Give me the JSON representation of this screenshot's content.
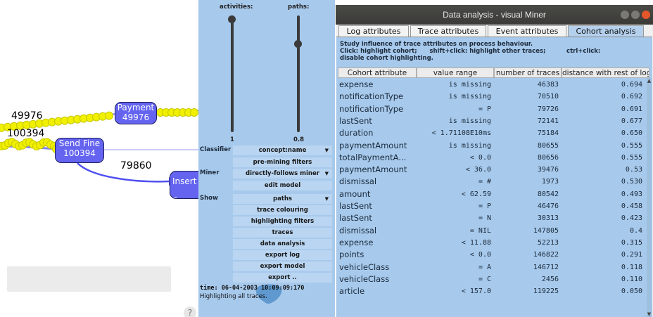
{
  "graph": {
    "nodes": [
      {
        "id": "payment",
        "label": "Payment",
        "count": "49976"
      },
      {
        "id": "send-fine",
        "label": "Send Fine",
        "count": "100394"
      },
      {
        "id": "insert-fine",
        "label": "Insert F"
      }
    ],
    "edge_labels": [
      "49976",
      "100394",
      "79860"
    ],
    "help_label": "?"
  },
  "panel": {
    "activities_label": "activities:",
    "paths_label": "paths:",
    "activities_value": "1",
    "paths_value": "0.8",
    "activities_level": 1.0,
    "paths_level": 0.8,
    "classifier_label": "Classifier",
    "classifier_value": "concept:name",
    "premining_button": "pre-mining filters",
    "miner_label": "Miner",
    "miner_value": "directly-follows miner",
    "edit_model_button": "edit model",
    "show_label": "Show",
    "show_value": "paths",
    "buttons": [
      "trace colouring",
      "highlighting filters",
      "traces",
      "data analysis",
      "export log",
      "export model",
      "export .."
    ],
    "status_time": "time: 06-04-2003 10:09:09:170",
    "status_message": "Highlighting all traces."
  },
  "window": {
    "title": "Data analysis - visual Miner",
    "tabs": [
      "Log attributes",
      "Trace attributes",
      "Event attributes",
      "Cohort analysis"
    ],
    "active_tab": "Cohort analysis",
    "description_line1": "Study influence of trace attributes on process behaviour.",
    "description_line2_a": "Click: highlight cohort;",
    "description_line2_b": "shift+click: highlight other traces;",
    "description_line2_c": "ctrl+click:",
    "description_line3": "disable cohort highlighting.",
    "columns": [
      "Cohort attribute",
      "value range",
      "number of traces",
      "distance with rest of log"
    ],
    "rows": [
      {
        "attribute": "expense",
        "range": "is missing",
        "traces": "46383",
        "distance": "0.694"
      },
      {
        "attribute": "notificationType",
        "range": "is missing",
        "traces": "70510",
        "distance": "0.692"
      },
      {
        "attribute": "notificationType",
        "range": "= P",
        "traces": "79726",
        "distance": "0.691"
      },
      {
        "attribute": "lastSent",
        "range": "is missing",
        "traces": "72141",
        "distance": "0.677"
      },
      {
        "attribute": "duration",
        "range": "< 1.71108E10ms",
        "traces": "75184",
        "distance": "0.650"
      },
      {
        "attribute": "paymentAmount",
        "range": "is missing",
        "traces": "80655",
        "distance": "0.555"
      },
      {
        "attribute": "totalPaymentA...",
        "range": "< 0.0",
        "traces": "80656",
        "distance": "0.555"
      },
      {
        "attribute": "paymentAmount",
        "range": "< 36.0",
        "traces": "39476",
        "distance": "0.53"
      },
      {
        "attribute": "dismissal",
        "range": "= #",
        "traces": "1973",
        "distance": "0.530"
      },
      {
        "attribute": "amount",
        "range": "< 62.59",
        "traces": "80542",
        "distance": "0.493"
      },
      {
        "attribute": "lastSent",
        "range": "= P",
        "traces": "46476",
        "distance": "0.458"
      },
      {
        "attribute": "lastSent",
        "range": "= N",
        "traces": "30313",
        "distance": "0.423"
      },
      {
        "attribute": "dismissal",
        "range": "= NIL",
        "traces": "147805",
        "distance": "0.4"
      },
      {
        "attribute": "expense",
        "range": "< 11.88",
        "traces": "52213",
        "distance": "0.315"
      },
      {
        "attribute": "points",
        "range": "< 0.0",
        "traces": "146822",
        "distance": "0.291"
      },
      {
        "attribute": "vehicleClass",
        "range": "= A",
        "traces": "146712",
        "distance": "0.118"
      },
      {
        "attribute": "vehicleClass",
        "range": "= C",
        "traces": "2456",
        "distance": "0.110"
      },
      {
        "attribute": "article",
        "range": "< 157.0",
        "traces": "119225",
        "distance": "0.050"
      }
    ]
  },
  "colors": {
    "node_fill": "#6464f0",
    "token_fill": "#f0f000",
    "panel_bg": "#a7c9ec",
    "titlebar": "#3c3b37",
    "close_button": "#e5562a"
  }
}
